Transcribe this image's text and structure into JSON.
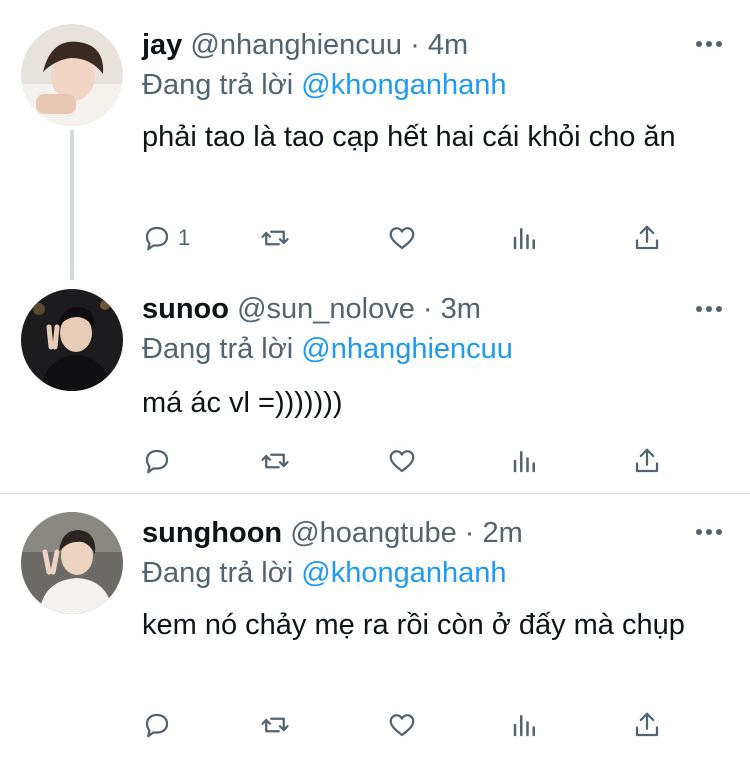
{
  "colors": {
    "link": "#1d9bf0",
    "muted": "#536471",
    "text": "#0f1419"
  },
  "tweets": [
    {
      "name": "jay",
      "handle": "@nhanghiencuu",
      "sep": "·",
      "time": "4m",
      "replying_prefix": "Đang trả lời",
      "replying_to": "@khonganhanh",
      "text": "phải tao là tao cạp hết hai cái khỏi cho ăn",
      "reply_count": "1"
    },
    {
      "name": "sunoo",
      "handle": "@sun_nolove",
      "sep": "·",
      "time": "3m",
      "replying_prefix": "Đang trả lời",
      "replying_to": "@nhanghiencuu",
      "text": "má ác vl =)))))))",
      "reply_count": ""
    },
    {
      "name": "sunghoon",
      "handle": "@hoangtube",
      "sep": "·",
      "time": "2m",
      "replying_prefix": "Đang trả lời",
      "replying_to": "@khonganhanh",
      "text": "kem nó chảy mẹ ra rồi còn ở đấy mà chụp",
      "reply_count": ""
    }
  ],
  "icons": [
    "reply-icon",
    "retweet-icon",
    "like-icon",
    "views-icon",
    "share-icon",
    "more-icon"
  ]
}
